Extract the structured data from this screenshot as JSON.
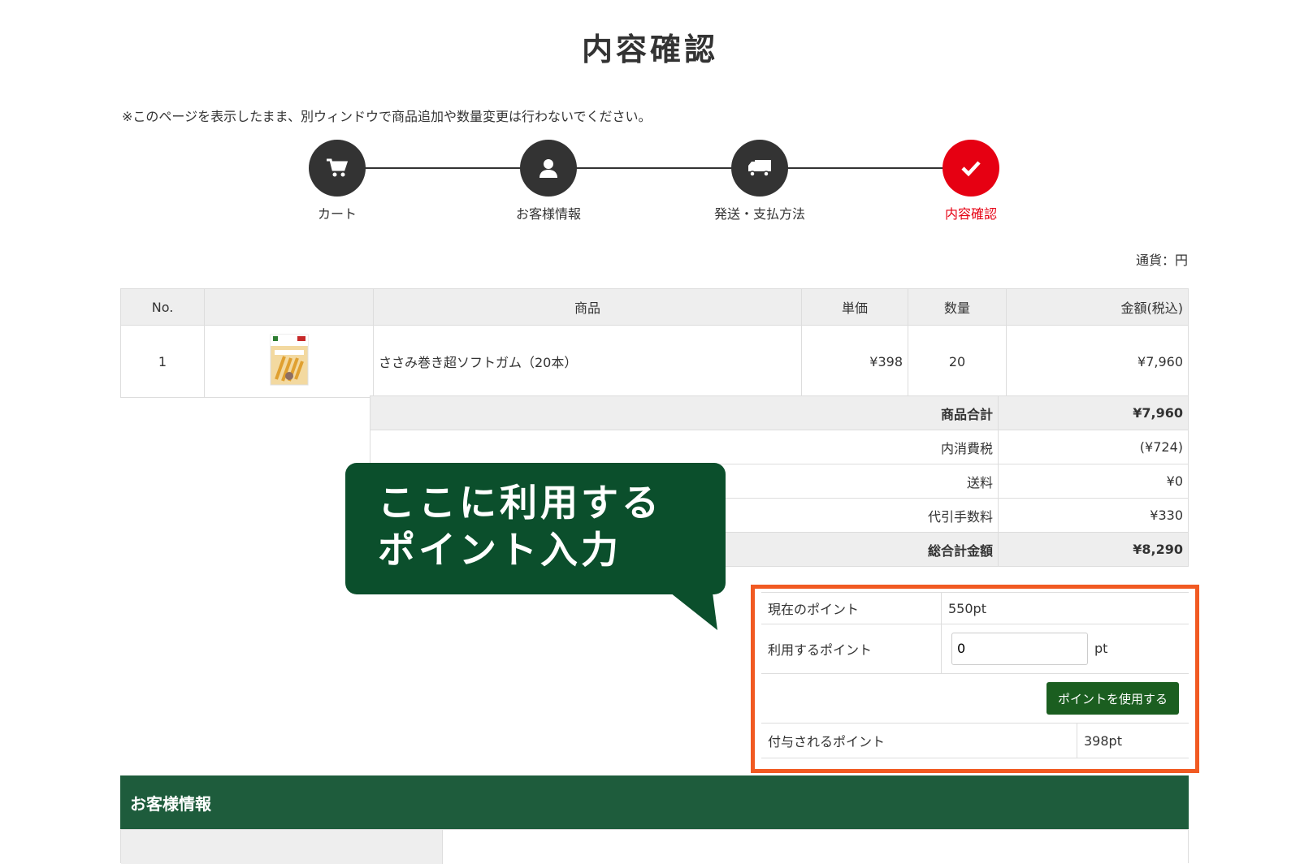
{
  "page": {
    "title": "内容確認",
    "notice": "※このページを表示したまま、別ウィンドウで商品追加や数量変更は行わないでください。"
  },
  "steps": [
    {
      "label": "カート",
      "icon": "cart-icon",
      "active": false
    },
    {
      "label": "お客様情報",
      "icon": "user-icon",
      "active": false
    },
    {
      "label": "発送・支払方法",
      "icon": "truck-icon",
      "active": false
    },
    {
      "label": "内容確認",
      "icon": "check-icon",
      "active": true
    }
  ],
  "currency": "通貨：円",
  "table": {
    "headers": {
      "no": "No.",
      "image": "",
      "product": "商品",
      "unit_price": "単価",
      "qty": "数量",
      "amount": "金額(税込)"
    },
    "rows": [
      {
        "no": "1",
        "product": "ささみ巻き超ソフトガム（20本）",
        "unit_price": "¥398",
        "qty": "20",
        "amount": "¥7,960"
      }
    ]
  },
  "summary": [
    {
      "label": "商品合計",
      "value": "¥7,960"
    },
    {
      "label": "内消費税",
      "value": "(¥724)"
    },
    {
      "label": "送料",
      "value": "¥0"
    },
    {
      "label": "代引手数料",
      "value": "¥330"
    },
    {
      "label": "総合計金額",
      "value": "¥8,290"
    }
  ],
  "callout": {
    "line1": "ここに利用する",
    "line2": "ポイント入力"
  },
  "points": {
    "current_label": "現在のポイント",
    "current_value": "550pt",
    "use_label": "利用するポイント",
    "use_value": "0",
    "use_unit": "pt",
    "apply_button": "ポイントを使用する",
    "granted_label": "付与されるポイント",
    "granted_value": "398pt"
  },
  "customer": {
    "heading": "お客様情報"
  },
  "colors": {
    "accent_red": "#e60012",
    "brand_green": "#1e5c3c",
    "callout_green": "#0b4f2c",
    "highlight_orange": "#f15a22"
  }
}
